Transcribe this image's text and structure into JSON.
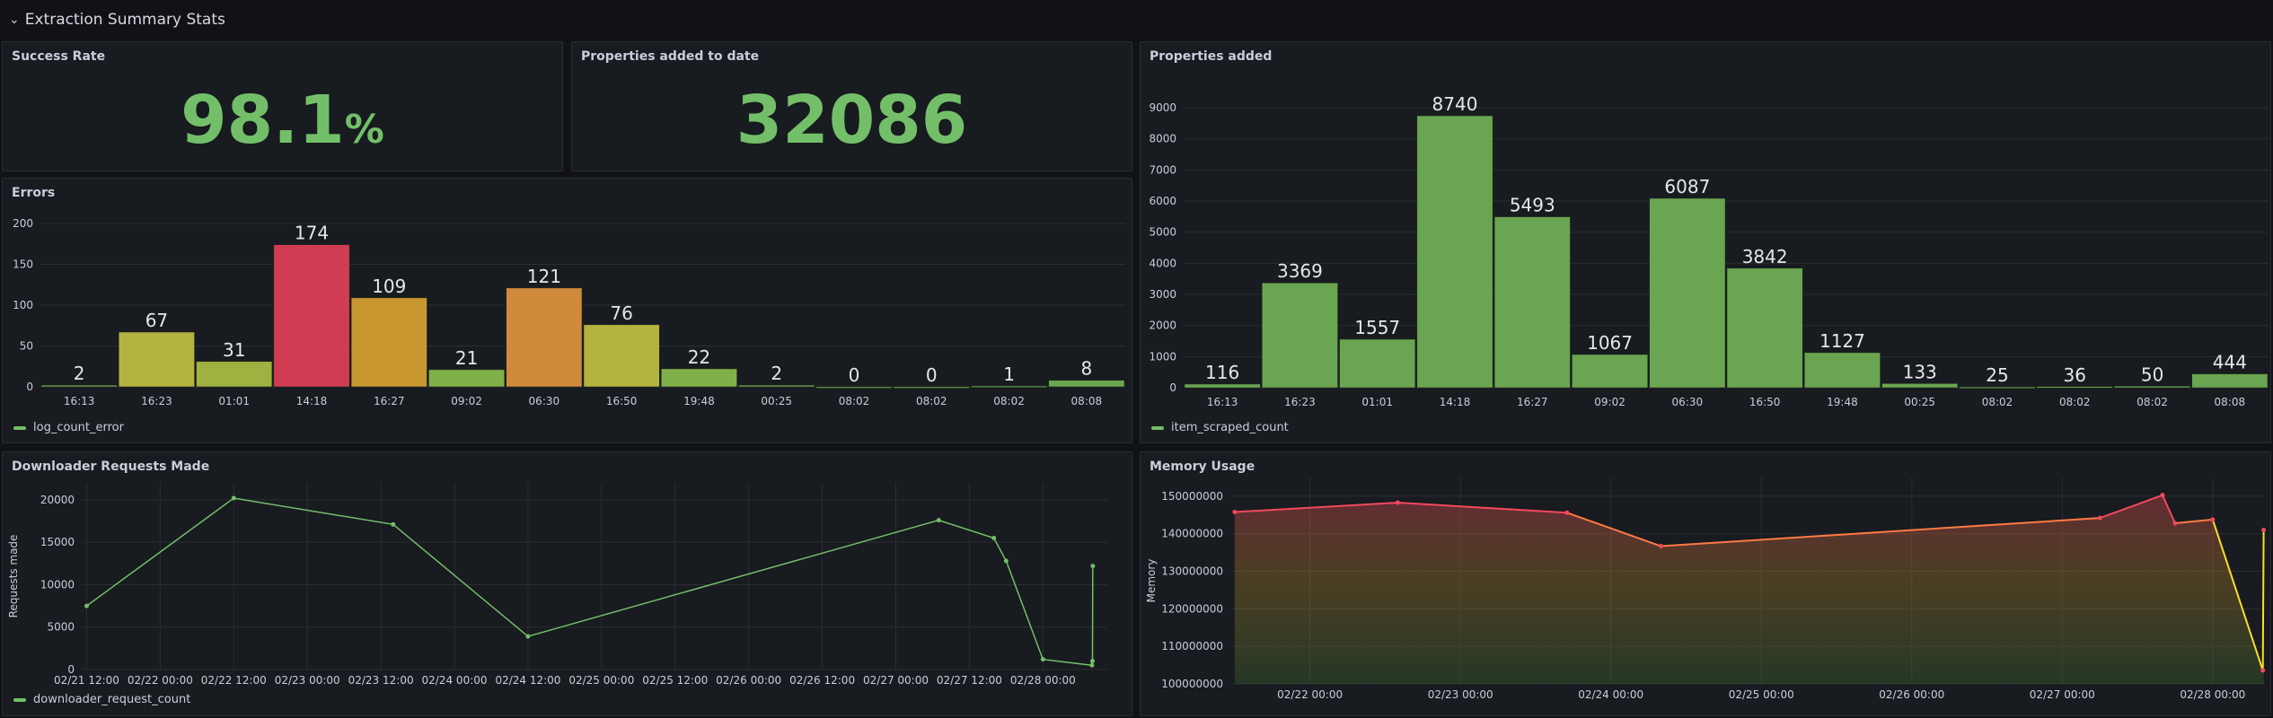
{
  "row": {
    "title": "Extraction Summary Stats"
  },
  "success_rate": {
    "title": "Success Rate",
    "value": "98.1",
    "unit": "%"
  },
  "properties_to_date": {
    "title": "Properties added to date",
    "value": "32086"
  },
  "errors_panel": {
    "title": "Errors",
    "legend": "log_count_error"
  },
  "props_added_panel": {
    "title": "Properties added",
    "legend": "item_scraped_count"
  },
  "downloader_panel": {
    "title": "Downloader Requests Made",
    "legend": "downloader_request_count"
  },
  "memory_panel": {
    "title": "Memory Usage"
  },
  "colors": {
    "green": "#73bf69",
    "bar_green": "#6aa551",
    "olive": "#b5b33f",
    "orange_yellow": "#c9972f",
    "orange": "#cf8a3c",
    "red": "#d03d52",
    "bg": "#181b1f",
    "grid": "#2a2d33"
  },
  "chart_data": [
    {
      "id": "errors",
      "type": "bar",
      "categories": [
        "16:13",
        "16:23",
        "01:01",
        "14:18",
        "16:27",
        "09:02",
        "06:30",
        "16:50",
        "19:48",
        "00:25",
        "08:02",
        "08:02",
        "08:02",
        "08:08"
      ],
      "series": [
        {
          "name": "log_count_error",
          "values": [
            2,
            67,
            31,
            174,
            109,
            21,
            121,
            76,
            22,
            2,
            0,
            0,
            1,
            8
          ]
        }
      ],
      "ylim": [
        0,
        200
      ],
      "yticks": [
        0,
        50,
        100,
        150,
        200
      ],
      "bar_colors": [
        "#6aa551",
        "#b5b33f",
        "#9fb241",
        "#d03d52",
        "#c9972f",
        "#80b04a",
        "#cf8a3c",
        "#b5b33f",
        "#80b04a",
        "#6aa551",
        "#6aa551",
        "#6aa551",
        "#6aa551",
        "#6aa551"
      ]
    },
    {
      "id": "properties_added",
      "type": "bar",
      "categories": [
        "16:13",
        "16:23",
        "01:01",
        "14:18",
        "16:27",
        "09:02",
        "06:30",
        "16:50",
        "19:48",
        "00:25",
        "08:02",
        "08:02",
        "08:02",
        "08:08"
      ],
      "series": [
        {
          "name": "item_scraped_count",
          "values": [
            116,
            3369,
            1557,
            8740,
            5493,
            1067,
            6087,
            3842,
            1127,
            133,
            25,
            36,
            50,
            444
          ]
        }
      ],
      "ylim": [
        0,
        9000
      ],
      "yticks": [
        0,
        1000,
        2000,
        3000,
        4000,
        5000,
        6000,
        7000,
        8000,
        9000
      ]
    },
    {
      "id": "downloader_requests",
      "type": "line",
      "ylabel": "Requests made",
      "x_tick_labels": [
        "02/21 12:00",
        "02/22 00:00",
        "02/22 12:00",
        "02/23 00:00",
        "02/23 12:00",
        "02/24 00:00",
        "02/24 12:00",
        "02/25 00:00",
        "02/25 12:00",
        "02/26 00:00",
        "02/26 12:00",
        "02/27 00:00",
        "02/27 12:00",
        "02/28 00:00"
      ],
      "x_start": "02/21 12:00",
      "ylim": [
        0,
        22000
      ],
      "yticks": [
        0,
        5000,
        10000,
        15000,
        20000
      ],
      "series": [
        {
          "name": "downloader_request_count",
          "points": [
            [
              "02/21 12:00",
              7500
            ],
            [
              "02/22 12:00",
              20200
            ],
            [
              "02/23 14:00",
              17100
            ],
            [
              "02/24 12:00",
              3900
            ],
            [
              "02/27 07:00",
              17600
            ],
            [
              "02/27 16:00",
              15500
            ],
            [
              "02/27 18:00",
              12800
            ],
            [
              "02/28 00:00",
              1200
            ],
            [
              "02/28 08:00",
              500
            ],
            [
              "02/28 08:05",
              1000
            ],
            [
              "02/28 08:08",
              12200
            ]
          ]
        }
      ]
    },
    {
      "id": "memory_usage",
      "type": "area",
      "ylabel": "Memory",
      "x_tick_labels": [
        "02/22 00:00",
        "02/23 00:00",
        "02/24 00:00",
        "02/25 00:00",
        "02/26 00:00",
        "02/27 00:00",
        "02/28 00:00"
      ],
      "ylim": [
        100000000,
        155000000
      ],
      "yticks": [
        100000000,
        110000000,
        120000000,
        130000000,
        140000000,
        150000000
      ],
      "series": [
        {
          "name": "memory",
          "points": [
            [
              "02/21 12:00",
              145800000
            ],
            [
              "02/22 14:00",
              148300000
            ],
            [
              "02/23 17:00",
              145600000
            ],
            [
              "02/24 08:00",
              136700000
            ],
            [
              "02/27 06:00",
              144200000
            ],
            [
              "02/27 16:00",
              150300000
            ],
            [
              "02/27 18:00",
              142800000
            ],
            [
              "02/28 00:00",
              143800000
            ],
            [
              "02/28 08:00",
              103600000
            ],
            [
              "02/28 08:08",
              141000000
            ]
          ]
        }
      ]
    }
  ]
}
